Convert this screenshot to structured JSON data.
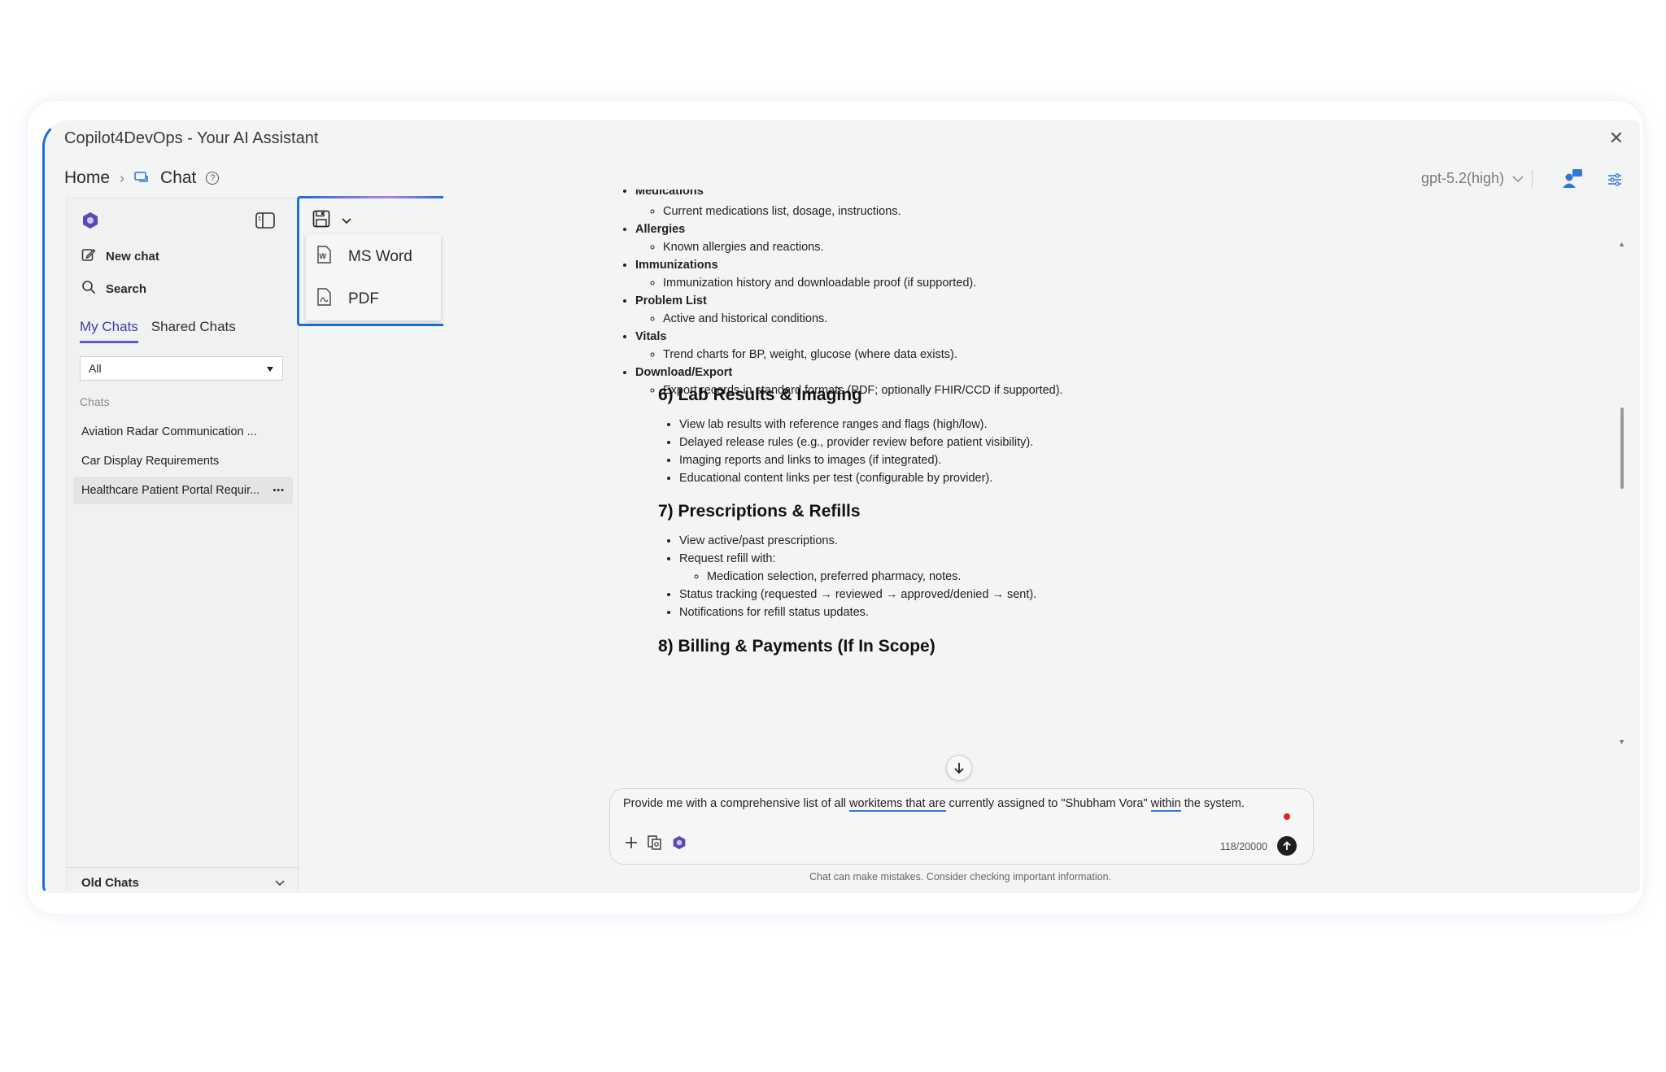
{
  "window": {
    "title": "Copilot4DevOps - Your AI Assistant"
  },
  "breadcrumb": {
    "home": "Home",
    "current": "Chat"
  },
  "header": {
    "model": "gpt-5.2(high)"
  },
  "sidebar": {
    "new_chat": "New chat",
    "search": "Search",
    "tabs": [
      "My Chats",
      "Shared Chats"
    ],
    "filter_value": "All",
    "chats_label": "Chats",
    "chats": [
      "Aviation Radar Communication ...",
      "Car Display Requirements",
      "Healthcare Patient Portal Requir..."
    ],
    "more": "•••",
    "old_chats": "Old Chats"
  },
  "export_menu": {
    "items": [
      "MS Word",
      "PDF"
    ]
  },
  "content": {
    "cut_top": "Medications",
    "meds": "Current medications list, dosage, instructions.",
    "allergies_h": "Allergies",
    "allergies": "Known allergies and reactions.",
    "immun_h": "Immunizations",
    "immun": "Immunization history and downloadable proof (if supported).",
    "problem_h": "Problem List",
    "problem": "Active and historical conditions.",
    "vitals_h": "Vitals",
    "vitals": "Trend charts for BP, weight, glucose (where data exists).",
    "download_h": "Download/Export",
    "download": "Export records in standard formats (PDF; optionally FHIR/CCD if supported).",
    "sec6": "6) Lab Results & Imaging",
    "sec6_items": [
      "View lab results with reference ranges and flags (high/low).",
      "Delayed release rules (e.g., provider review before patient visibility).",
      "Imaging reports and links to images (if integrated).",
      "Educational content links per test (configurable by provider)."
    ],
    "sec7": "7) Prescriptions & Refills",
    "sec7_a": "View active/past prescriptions.",
    "sec7_b": "Request refill with:",
    "sec7_b_sub": "Medication selection, preferred pharmacy, notes.",
    "sec7_c": "Status tracking (requested → reviewed → approved/denied → sent).",
    "sec7_d": "Notifications for refill status updates.",
    "sec8": "8) Billing & Payments (If In Scope)"
  },
  "composer": {
    "p1": "Provide me with a comprehensive list of all ",
    "p2": "workitems that are",
    "p3": " currently assigned to \"Shubham Vora\" ",
    "p4": "within",
    "p5": " the system.",
    "counter": "118/20000",
    "disclaimer": "Chat can make mistakes. Consider checking important information."
  }
}
